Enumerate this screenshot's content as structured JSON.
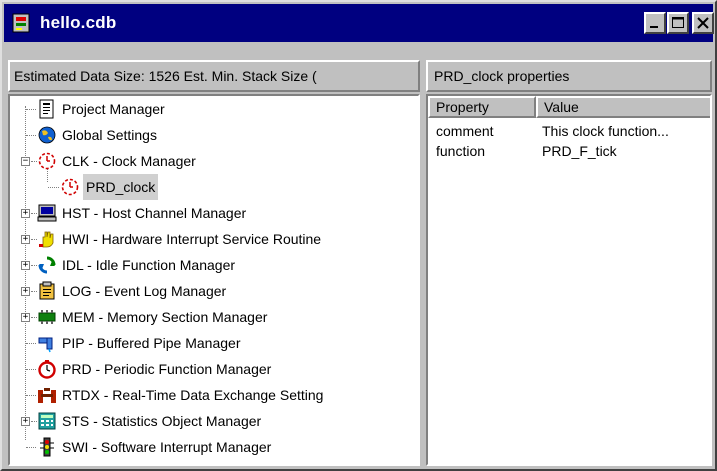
{
  "window": {
    "title": "hello.cdb"
  },
  "left_header": "Estimated Data Size: 1526  Est. Min. Stack Size (",
  "right_header": "PRD_clock properties",
  "tree": [
    {
      "label": "Project Manager",
      "icon": "project-manager-icon"
    },
    {
      "label": "Global Settings",
      "icon": "global-settings-icon"
    },
    {
      "label": "CLK - Clock Manager",
      "icon": "clock-icon"
    },
    {
      "label": "PRD_clock",
      "icon": "clock-object-icon"
    },
    {
      "label": "HST - Host Channel Manager",
      "icon": "host-channel-icon"
    },
    {
      "label": "HWI - Hardware Interrupt Service Routine",
      "icon": "hardware-interrupt-icon"
    },
    {
      "label": "IDL - Idle Function Manager",
      "icon": "idle-function-icon"
    },
    {
      "label": "LOG - Event Log Manager",
      "icon": "event-log-icon"
    },
    {
      "label": "MEM - Memory Section Manager",
      "icon": "memory-section-icon"
    },
    {
      "label": "PIP - Buffered Pipe Manager",
      "icon": "pipe-icon"
    },
    {
      "label": "PRD - Periodic Function Manager",
      "icon": "periodic-function-icon"
    },
    {
      "label": "RTDX - Real-Time Data Exchange Setting",
      "icon": "rtdx-icon"
    },
    {
      "label": "STS - Statistics Object Manager",
      "icon": "statistics-icon"
    },
    {
      "label": "SWI - Software Interrupt Manager",
      "icon": "software-interrupt-icon"
    }
  ],
  "properties": {
    "columns": [
      "Property",
      "Value"
    ],
    "rows": [
      {
        "property": "comment",
        "value": "This clock function..."
      },
      {
        "property": "function",
        "value": "PRD_F_tick"
      }
    ]
  }
}
